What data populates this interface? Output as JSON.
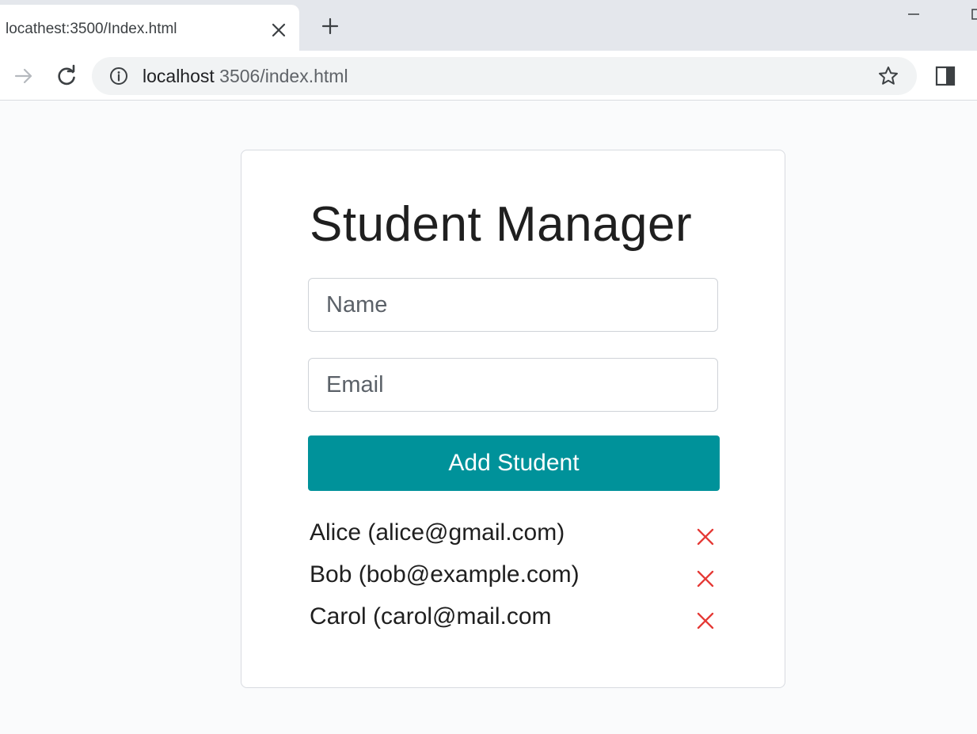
{
  "browser": {
    "tab_title": "locathest:3500/Index.html",
    "url_host": "localhost",
    "url_rest": " 3506/index.html",
    "icons": {
      "tab_close": "close-icon",
      "new_tab": "plus-icon",
      "forward": "arrow-right-icon",
      "reload": "reload-icon",
      "site_info": "info-icon",
      "bookmark": "star-icon",
      "side_panel": "side-panel-icon"
    }
  },
  "app": {
    "title": "Student Manager",
    "name_placeholder": "Name",
    "email_placeholder": "Email",
    "add_button_label": "Add Student",
    "accent_color": "#00929a",
    "delete_color": "#e53935",
    "students": [
      {
        "label": "Alice (alice@gmail.com)"
      },
      {
        "label": "Bob (bob@example.com)"
      },
      {
        "label": "Carol (carol@mail.com"
      }
    ]
  }
}
